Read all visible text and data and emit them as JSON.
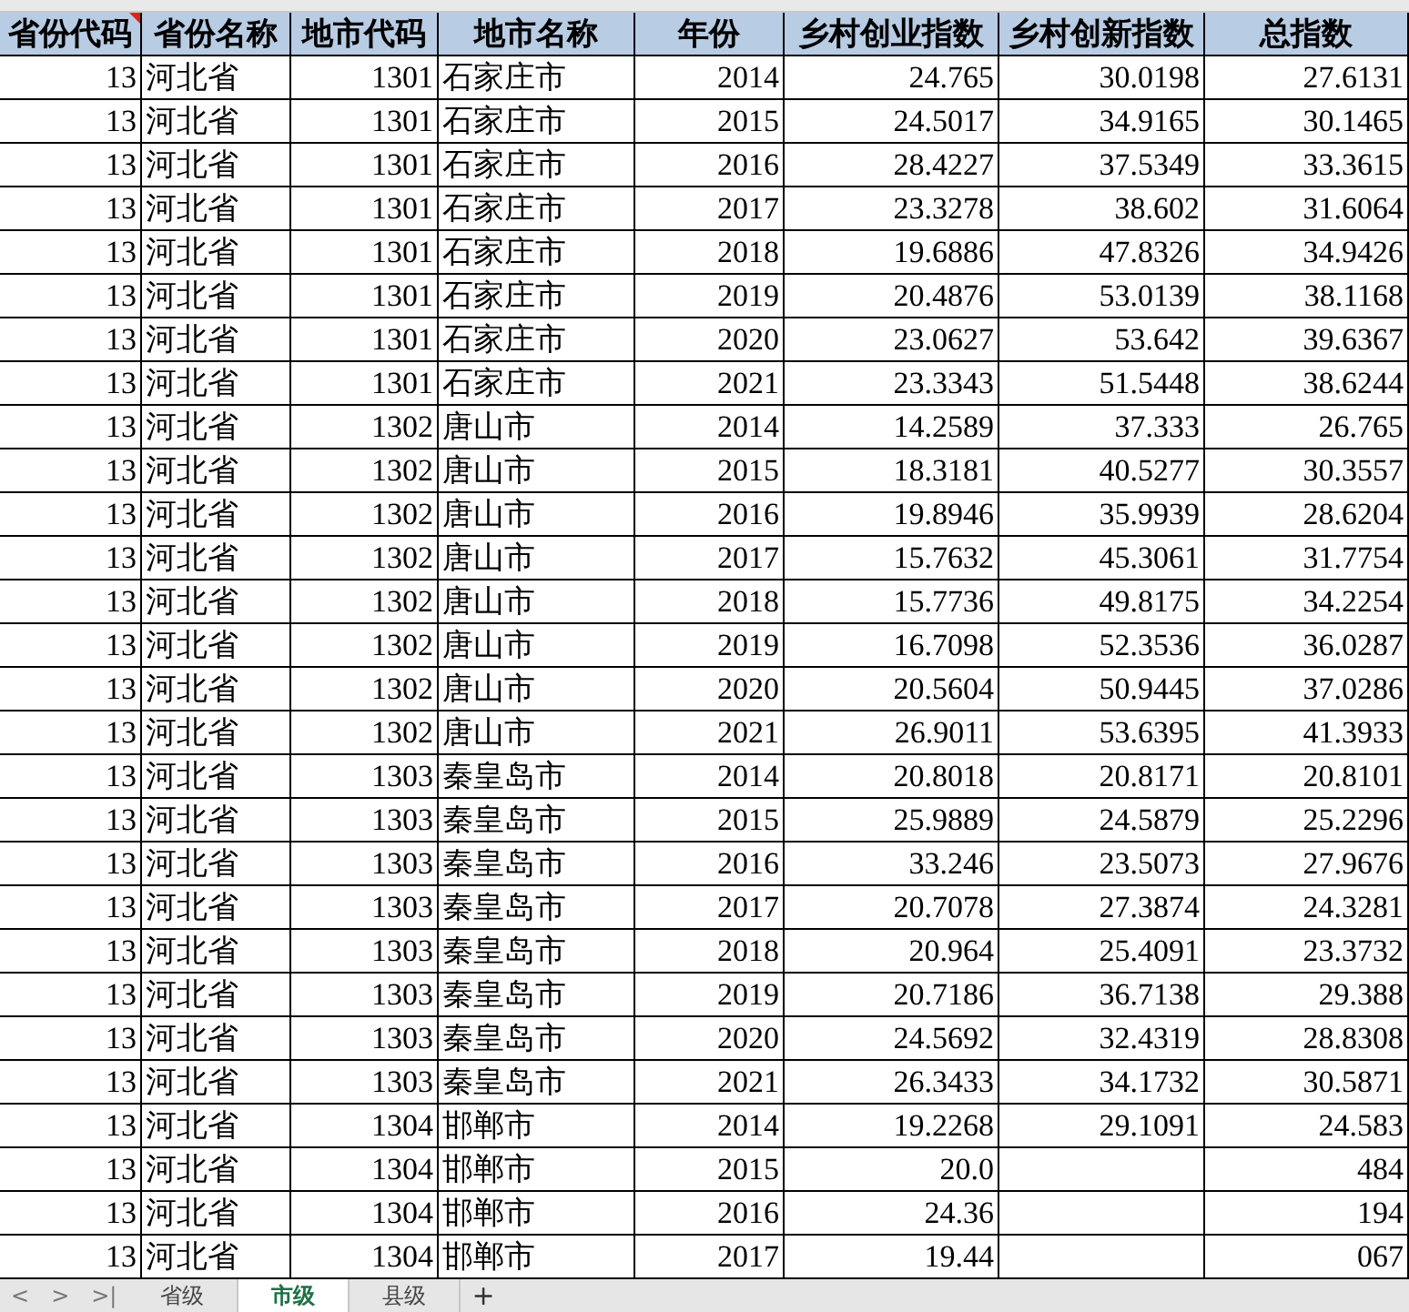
{
  "table": {
    "columns": [
      "省份代码",
      "省份名称",
      "地市代码",
      "地市名称",
      "年份",
      "乡村创业指数",
      "乡村创新指数",
      "总指数"
    ],
    "rows": [
      [
        "13",
        "河北省",
        "1301",
        "石家庄市",
        "2014",
        "24.765",
        "30.0198",
        "27.6131"
      ],
      [
        "13",
        "河北省",
        "1301",
        "石家庄市",
        "2015",
        "24.5017",
        "34.9165",
        "30.1465"
      ],
      [
        "13",
        "河北省",
        "1301",
        "石家庄市",
        "2016",
        "28.4227",
        "37.5349",
        "33.3615"
      ],
      [
        "13",
        "河北省",
        "1301",
        "石家庄市",
        "2017",
        "23.3278",
        "38.602",
        "31.6064"
      ],
      [
        "13",
        "河北省",
        "1301",
        "石家庄市",
        "2018",
        "19.6886",
        "47.8326",
        "34.9426"
      ],
      [
        "13",
        "河北省",
        "1301",
        "石家庄市",
        "2019",
        "20.4876",
        "53.0139",
        "38.1168"
      ],
      [
        "13",
        "河北省",
        "1301",
        "石家庄市",
        "2020",
        "23.0627",
        "53.642",
        "39.6367"
      ],
      [
        "13",
        "河北省",
        "1301",
        "石家庄市",
        "2021",
        "23.3343",
        "51.5448",
        "38.6244"
      ],
      [
        "13",
        "河北省",
        "1302",
        "唐山市",
        "2014",
        "14.2589",
        "37.333",
        "26.765"
      ],
      [
        "13",
        "河北省",
        "1302",
        "唐山市",
        "2015",
        "18.3181",
        "40.5277",
        "30.3557"
      ],
      [
        "13",
        "河北省",
        "1302",
        "唐山市",
        "2016",
        "19.8946",
        "35.9939",
        "28.6204"
      ],
      [
        "13",
        "河北省",
        "1302",
        "唐山市",
        "2017",
        "15.7632",
        "45.3061",
        "31.7754"
      ],
      [
        "13",
        "河北省",
        "1302",
        "唐山市",
        "2018",
        "15.7736",
        "49.8175",
        "34.2254"
      ],
      [
        "13",
        "河北省",
        "1302",
        "唐山市",
        "2019",
        "16.7098",
        "52.3536",
        "36.0287"
      ],
      [
        "13",
        "河北省",
        "1302",
        "唐山市",
        "2020",
        "20.5604",
        "50.9445",
        "37.0286"
      ],
      [
        "13",
        "河北省",
        "1302",
        "唐山市",
        "2021",
        "26.9011",
        "53.6395",
        "41.3933"
      ],
      [
        "13",
        "河北省",
        "1303",
        "秦皇岛市",
        "2014",
        "20.8018",
        "20.8171",
        "20.8101"
      ],
      [
        "13",
        "河北省",
        "1303",
        "秦皇岛市",
        "2015",
        "25.9889",
        "24.5879",
        "25.2296"
      ],
      [
        "13",
        "河北省",
        "1303",
        "秦皇岛市",
        "2016",
        "33.246",
        "23.5073",
        "27.9676"
      ],
      [
        "13",
        "河北省",
        "1303",
        "秦皇岛市",
        "2017",
        "20.7078",
        "27.3874",
        "24.3281"
      ],
      [
        "13",
        "河北省",
        "1303",
        "秦皇岛市",
        "2018",
        "20.964",
        "25.4091",
        "23.3732"
      ],
      [
        "13",
        "河北省",
        "1303",
        "秦皇岛市",
        "2019",
        "20.7186",
        "36.7138",
        "29.388"
      ],
      [
        "13",
        "河北省",
        "1303",
        "秦皇岛市",
        "2020",
        "24.5692",
        "32.4319",
        "28.8308"
      ],
      [
        "13",
        "河北省",
        "1303",
        "秦皇岛市",
        "2021",
        "26.3433",
        "34.1732",
        "30.5871"
      ],
      [
        "13",
        "河北省",
        "1304",
        "邯郸市",
        "2014",
        "19.2268",
        "29.1091",
        "24.583"
      ],
      [
        "13",
        "河北省",
        "1304",
        "邯郸市",
        "2015",
        "20.0",
        null,
        "484"
      ],
      [
        "13",
        "河北省",
        "1304",
        "邯郸市",
        "2016",
        "24.36",
        null,
        "194"
      ],
      [
        "13",
        "河北省",
        "1304",
        "邯郸市",
        "2017",
        "19.44",
        null,
        "067"
      ]
    ]
  },
  "sheet_nav": [
    "<",
    ">",
    ">|"
  ],
  "sheet_tabs": [
    {
      "label": "省级",
      "selected": false
    },
    {
      "label": "市级",
      "selected": true
    },
    {
      "label": "县级",
      "selected": false
    }
  ],
  "add_sheet": "+"
}
